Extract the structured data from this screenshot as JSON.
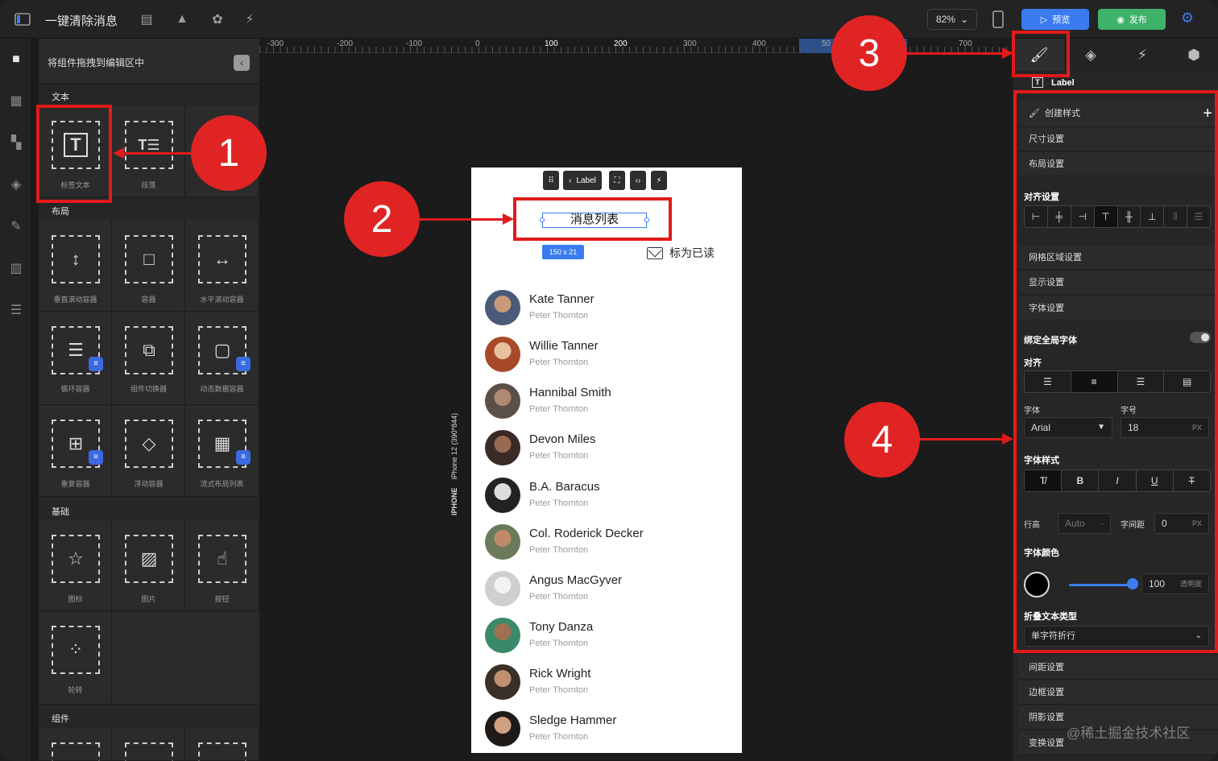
{
  "app": {
    "title": "一键清除消息",
    "zoom": "82%",
    "preview_label": "预览",
    "publish_label": "发布"
  },
  "left_panel": {
    "header": "将组件拖拽到编辑区中",
    "sections": {
      "text": "文本",
      "layout": "布局",
      "basic": "基础",
      "components": "组件"
    },
    "text_items": [
      "标签文本",
      "段落"
    ],
    "layout_items": [
      "垂直滚动容器",
      "容器",
      "水平滚动容器",
      "循环容器",
      "组件切换器",
      "动态数据容器",
      "重复容器",
      "浮动容器",
      "流式布局列表"
    ],
    "basic_items": [
      "图标",
      "图片",
      "按钮",
      "轮转"
    ]
  },
  "ruler": {
    "marks": [
      "-300",
      "-200",
      "-100",
      "0",
      "100",
      "200",
      "300",
      "400",
      "50",
      "700"
    ]
  },
  "device_label": {
    "prefix": "IPHONE",
    "model": "iPhone 12 (390*844)"
  },
  "phone": {
    "toolbar_label": "Label",
    "title": "消息列表",
    "size_badge": "150 x 21",
    "mark_read": "标为已读",
    "contacts": [
      {
        "name": "Kate Tanner",
        "sub": "Peter Thornton"
      },
      {
        "name": "Willie Tanner",
        "sub": "Peter Thornton"
      },
      {
        "name": "Hannibal Smith",
        "sub": "Peter Thornton"
      },
      {
        "name": "Devon Miles",
        "sub": "Peter Thornton"
      },
      {
        "name": "B.A. Baracus",
        "sub": "Peter Thornton"
      },
      {
        "name": "Col. Roderick Decker",
        "sub": "Peter Thornton"
      },
      {
        "name": "Angus MacGyver",
        "sub": "Peter Thornton"
      },
      {
        "name": "Tony Danza",
        "sub": "Peter Thornton"
      },
      {
        "name": "Rick Wright",
        "sub": "Peter Thornton"
      },
      {
        "name": "Sledge Hammer",
        "sub": "Peter Thornton"
      }
    ]
  },
  "right_panel": {
    "selected": "Label",
    "create_style": "创建样式",
    "size": "尺寸设置",
    "layout": "布局设置",
    "align_section": "对齐设置",
    "grid": "网格区域设置",
    "display": "显示设置",
    "font": "字体设置",
    "bind_global_font": "绑定全局字体",
    "align": "对齐",
    "font_family_label": "字体",
    "font_size_label": "字号",
    "font_family": "Arial",
    "font_size": "18",
    "unit": "PX",
    "font_style": "字体样式",
    "line_height_label": "行高",
    "line_height": "Auto",
    "letter_spacing_label": "字间距",
    "letter_spacing": "0",
    "font_color": "字体颜色",
    "opacity": "100",
    "opacity_label": "透明度",
    "wrap_type_label": "折叠文本类型",
    "wrap_type": "单字符折行",
    "spacing": "间距设置",
    "border": "边框设置",
    "shadow": "阴影设置",
    "transform": "变换设置"
  },
  "annotations": [
    "1",
    "2",
    "3",
    "4"
  ],
  "watermark": "@稀土掘金技术社区",
  "colors": {
    "accent": "#3a7cf0",
    "annotation": "#e21a1a",
    "publish": "#3fb26a"
  }
}
